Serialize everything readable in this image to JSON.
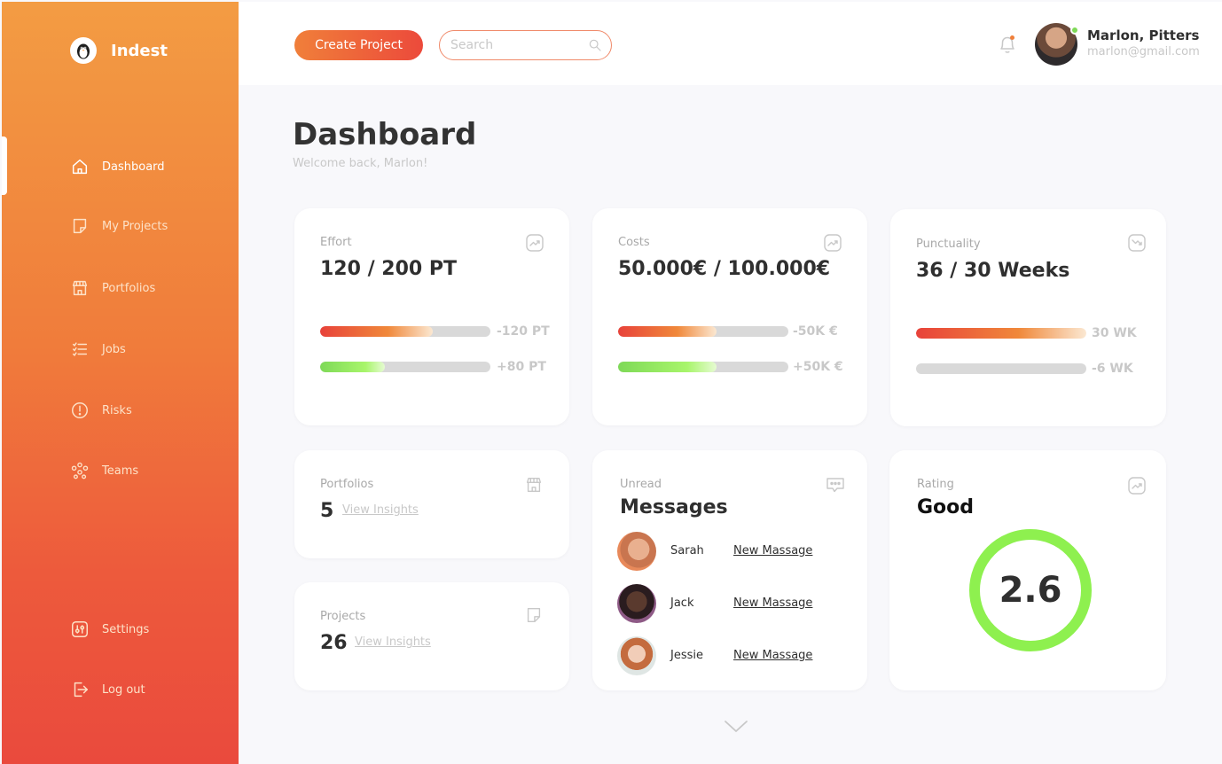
{
  "app": {
    "name": "Indest"
  },
  "sidebar": {
    "items": [
      {
        "label": "Dashboard",
        "icon": "home-icon",
        "active": true
      },
      {
        "label": "My Projects",
        "icon": "note-icon"
      },
      {
        "label": "Portfolios",
        "icon": "store-icon"
      },
      {
        "label": "Jobs",
        "icon": "list-icon"
      },
      {
        "label": "Risks",
        "icon": "alert-circle-icon"
      },
      {
        "label": "Teams",
        "icon": "team-icon"
      }
    ],
    "bottom_items": [
      {
        "label": "Settings",
        "icon": "settings-sliders-icon"
      },
      {
        "label": "Log out",
        "icon": "logout-icon"
      }
    ]
  },
  "topbar": {
    "create_label": "Create Project",
    "search_placeholder": "Search",
    "user": {
      "name": "Marlon, Pitters",
      "email": "marlon@gmail.com",
      "online": true
    }
  },
  "header": {
    "title": "Dashboard",
    "subtitle": "Welcome back, Marlon!"
  },
  "cards": {
    "effort": {
      "label": "Effort",
      "value": "120 / 200 PT",
      "bar1_text": "-120 PT",
      "bar1_fill": 0.66,
      "bar2_text": "+80 PT",
      "bar2_fill": 0.38
    },
    "costs": {
      "label": "Costs",
      "value": "50.000€ / 100.000€",
      "bar1_text": "-50K €",
      "bar1_fill": 0.58,
      "bar2_text": "+50K €",
      "bar2_fill": 0.58
    },
    "punctuality": {
      "label": "Punctuality",
      "value": "36 / 30 Weeks",
      "bar1_text": "30 WK",
      "bar1_fill": 1.0,
      "bar2_text": "-6 WK",
      "bar2_fill": 0
    },
    "portfolios": {
      "label": "Portfolios",
      "value": "5",
      "link": "View Insights"
    },
    "projects": {
      "label": "Projects",
      "value": "26",
      "link": "View Insights"
    },
    "messages": {
      "label": "Unread",
      "title": "Messages",
      "items": [
        {
          "name": "Sarah",
          "link": "New Massage"
        },
        {
          "name": "Jack",
          "link": "New Massage"
        },
        {
          "name": "Jessie",
          "link": "New Massage"
        }
      ]
    },
    "rating": {
      "label": "Rating",
      "title": "Good",
      "value": "2.6"
    }
  },
  "colors": {
    "accent_orange": "#f39c43",
    "accent_red": "#ea4a3d",
    "green": "#7ed957"
  }
}
